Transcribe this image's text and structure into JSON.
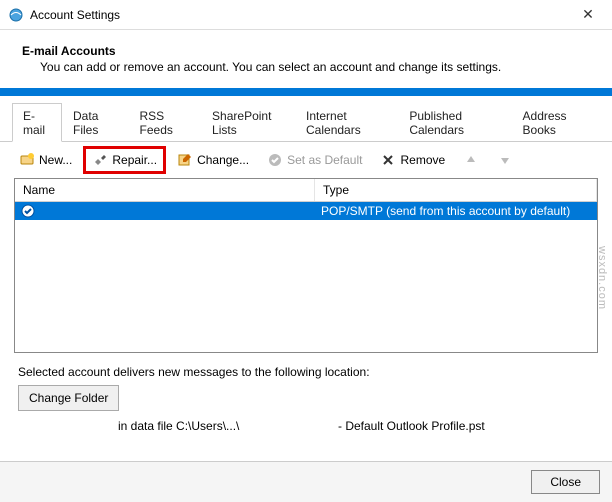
{
  "window": {
    "title": "Account Settings",
    "heading": "E-mail Accounts",
    "subtext": "You can add or remove an account. You can select an account and change its settings."
  },
  "tabs": {
    "email": "E-mail",
    "datafiles": "Data Files",
    "rss": "RSS Feeds",
    "sharepoint": "SharePoint Lists",
    "internet_cal": "Internet Calendars",
    "published_cal": "Published Calendars",
    "address_books": "Address Books"
  },
  "toolbar": {
    "new": "New...",
    "repair": "Repair...",
    "change": "Change...",
    "set_default": "Set as Default",
    "remove": "Remove"
  },
  "columns": {
    "name": "Name",
    "type": "Type"
  },
  "accounts": [
    {
      "name": "",
      "type": "POP/SMTP (send from this account by default)"
    }
  ],
  "delivery": {
    "label": "Selected account delivers new messages to the following location:",
    "change_folder": "Change Folder",
    "path_prefix": "in data file C:\\Users\\...\\",
    "path_suffix": "- Default Outlook Profile.pst"
  },
  "buttons": {
    "close": "Close"
  },
  "watermark": "wsxdn.com"
}
